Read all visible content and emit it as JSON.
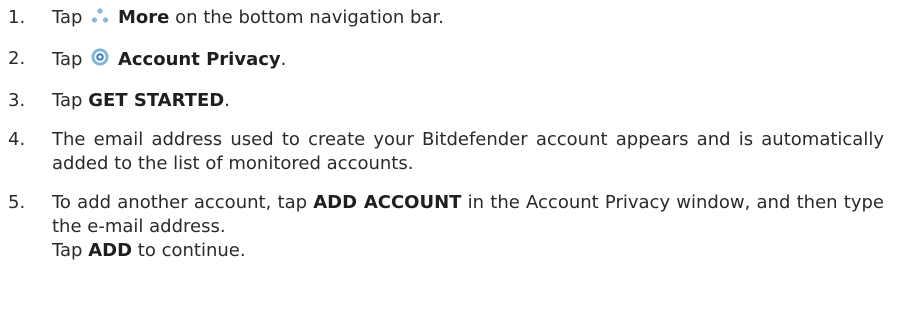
{
  "steps": [
    {
      "number": "1.",
      "pre": "Tap",
      "icon": "more-dots-icon",
      "bold": "More",
      "post": "on the bottom navigation bar."
    },
    {
      "number": "2.",
      "pre": "Tap",
      "icon": "account-privacy-icon",
      "bold": "Account Privacy",
      "post": "."
    },
    {
      "number": "3.",
      "pre": "Tap",
      "bold": "GET STARTED",
      "post": "."
    },
    {
      "number": "4.",
      "text": "The email address used to create your Bitdefender account appears and is automatically added to the list of monitored accounts."
    },
    {
      "number": "5.",
      "pre": "To add another account, tap",
      "bold": "ADD ACCOUNT",
      "post": "in the Account Privacy window, and then type the e-mail address.",
      "line2_pre": "Tap",
      "line2_bold": "ADD",
      "line2_post": "to continue."
    }
  ],
  "colors": {
    "text": "#2a2a2a",
    "icon_dots": "#8fb8d8",
    "icon_privacy_ring": "#7fb3d9",
    "icon_privacy_center": "#3d7fbf"
  }
}
